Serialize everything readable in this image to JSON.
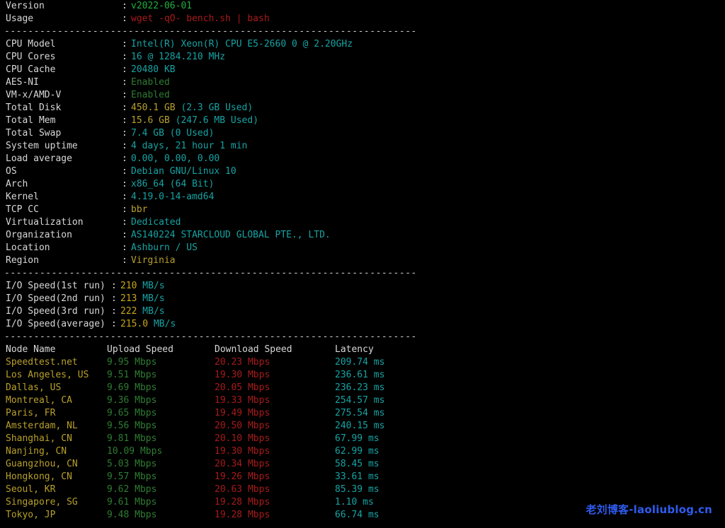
{
  "terminal": {
    "background": "#000000",
    "foreground": "#d8d8d8",
    "divider": "----------------------------------------------------------------------",
    "colors": {
      "cyan": "#17a3a3",
      "green": "#1faf3e",
      "dim_green": "#2e7d32",
      "yellow": "#b8a02a",
      "red": "#a81a1a",
      "white": "#d8d8d8",
      "watermark_blue": "#2f5cf0"
    }
  },
  "header": {
    "version_label": "Version",
    "version_value": "v2022-06-01",
    "usage_label": "Usage",
    "usage_value": "wget -qO- bench.sh | bash",
    "colon": ":"
  },
  "system_info": [
    {
      "label": "CPU Model",
      "value": "Intel(R) Xeon(R) CPU E5-2660 0 @ 2.20GHz",
      "color": "cyan"
    },
    {
      "label": "CPU Cores",
      "value": "16 @ 1284.210 MHz",
      "color": "cyan"
    },
    {
      "label": "CPU Cache",
      "value": "20480 KB",
      "color": "cyan"
    },
    {
      "label": "AES-NI",
      "value": "Enabled",
      "color": "dim_green"
    },
    {
      "label": "VM-x/AMD-V",
      "value": "Enabled",
      "color": "dim_green"
    },
    {
      "label": "Total Disk",
      "value": "450.1 GB",
      "extra": " (2.3 GB Used)",
      "color": "yellow",
      "extra_color": "cyan"
    },
    {
      "label": "Total Mem",
      "value": "15.6 GB",
      "extra": " (247.6 MB Used)",
      "color": "yellow",
      "extra_color": "cyan"
    },
    {
      "label": "Total Swap",
      "value": "7.4 GB",
      "extra": " (0 Used)",
      "color": "cyan",
      "extra_color": "cyan"
    },
    {
      "label": "System uptime",
      "value": "4 days, 21 hour 1 min",
      "color": "cyan"
    },
    {
      "label": "Load average",
      "value": "0.00, 0.00, 0.00",
      "color": "cyan"
    },
    {
      "label": "OS",
      "value": "Debian GNU/Linux 10",
      "color": "cyan"
    },
    {
      "label": "Arch",
      "value": "x86_64 (64 Bit)",
      "color": "cyan"
    },
    {
      "label": "Kernel",
      "value": "4.19.0-14-amd64",
      "color": "cyan"
    },
    {
      "label": "TCP CC",
      "value": "bbr",
      "color": "yellow"
    },
    {
      "label": "Virtualization",
      "value": "Dedicated",
      "color": "cyan"
    },
    {
      "label": "Organization",
      "value": "AS140224 STARCLOUD GLOBAL PTE., LTD.",
      "color": "cyan"
    },
    {
      "label": "Location",
      "value": "Ashburn / US",
      "color": "cyan"
    },
    {
      "label": "Region",
      "value": "Virginia",
      "color": "yellow"
    }
  ],
  "io_speed": [
    {
      "label": "I/O Speed(1st run)",
      "value": "210",
      "unit": " MB/s"
    },
    {
      "label": "I/O Speed(2nd run)",
      "value": "213",
      "unit": " MB/s"
    },
    {
      "label": "I/O Speed(3rd run)",
      "value": "222",
      "unit": " MB/s"
    },
    {
      "label": "I/O Speed(average)",
      "value": "215.0",
      "unit": " MB/s"
    }
  ],
  "speedtest": {
    "headers": {
      "node": "Node Name",
      "upload": "Upload Speed",
      "download": "Download Speed",
      "latency": "Latency"
    },
    "rows": [
      {
        "node": "Speedtest.net",
        "upload": "9.95 Mbps",
        "download": "20.23 Mbps",
        "latency": "209.74 ms"
      },
      {
        "node": "Los Angeles, US",
        "upload": "9.51 Mbps",
        "download": "19.30 Mbps",
        "latency": "236.61 ms"
      },
      {
        "node": "Dallas, US",
        "upload": "9.69 Mbps",
        "download": "20.05 Mbps",
        "latency": "236.23 ms"
      },
      {
        "node": "Montreal, CA",
        "upload": "9.36 Mbps",
        "download": "19.33 Mbps",
        "latency": "254.57 ms"
      },
      {
        "node": "Paris, FR",
        "upload": "9.65 Mbps",
        "download": "19.49 Mbps",
        "latency": "275.54 ms"
      },
      {
        "node": "Amsterdam, NL",
        "upload": "9.56 Mbps",
        "download": "20.50 Mbps",
        "latency": "240.15 ms"
      },
      {
        "node": "Shanghai, CN",
        "upload": "9.81 Mbps",
        "download": "20.10 Mbps",
        "latency": "67.99 ms"
      },
      {
        "node": "Nanjing, CN",
        "upload": "10.09 Mbps",
        "download": "19.30 Mbps",
        "latency": "62.99 ms"
      },
      {
        "node": "Guangzhou, CN",
        "upload": "5.03 Mbps",
        "download": "20.34 Mbps",
        "latency": "58.45 ms"
      },
      {
        "node": "Hongkong, CN",
        "upload": "9.57 Mbps",
        "download": "19.26 Mbps",
        "latency": "33.61 ms"
      },
      {
        "node": "Seoul, KR",
        "upload": "9.62 Mbps",
        "download": "20.63 Mbps",
        "latency": "85.39 ms"
      },
      {
        "node": "Singapore, SG",
        "upload": "9.61 Mbps",
        "download": "19.28 Mbps",
        "latency": "1.10 ms"
      },
      {
        "node": "Tokyo, JP",
        "upload": "9.48 Mbps",
        "download": "19.28 Mbps",
        "latency": "66.74 ms"
      }
    ]
  },
  "watermark": {
    "text": "老刘博客-laoliublog.cn"
  }
}
